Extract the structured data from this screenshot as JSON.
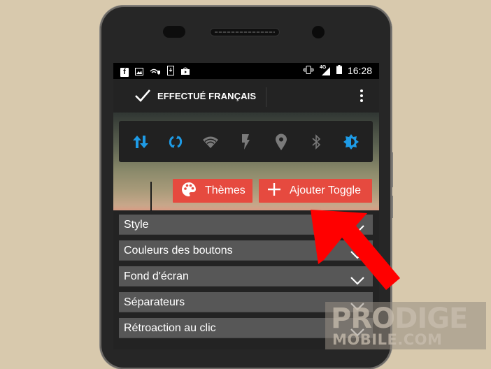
{
  "statusbar": {
    "left_icons": [
      "facebook-icon",
      "image-icon",
      "wifi-vpn-icon",
      "download-icon",
      "play-store-icon"
    ],
    "network_label": "4G",
    "time": "16:28"
  },
  "appbar": {
    "title": "EFFECTUÉ FRANÇAIS",
    "confirm_icon": "check-icon",
    "menu_icon": "more-vert-icon"
  },
  "toggles": [
    {
      "name": "mobile-data",
      "icon": "data-arrows-icon",
      "active": true
    },
    {
      "name": "sync",
      "icon": "sync-icon",
      "active": true
    },
    {
      "name": "wifi",
      "icon": "wifi-icon",
      "active": false
    },
    {
      "name": "flashlight",
      "icon": "flash-icon",
      "active": false
    },
    {
      "name": "location",
      "icon": "location-pin-icon",
      "active": false
    },
    {
      "name": "bluetooth",
      "icon": "bluetooth-icon",
      "active": false
    },
    {
      "name": "brightness",
      "icon": "brightness-icon",
      "active": true
    }
  ],
  "colors": {
    "active_toggle": "#1e9be6",
    "inactive_toggle": "#7a7a7a",
    "button_red": "#e64a3f",
    "annotation_arrow": "#ff0000"
  },
  "buttons": {
    "themes": "Thèmes",
    "add_toggle": "Ajouter Toggle"
  },
  "sections": [
    {
      "label": "Style"
    },
    {
      "label": "Couleurs des boutons"
    },
    {
      "label": "Fond d'écran"
    },
    {
      "label": "Séparateurs"
    },
    {
      "label": "Rétroaction au clic"
    }
  ],
  "watermark": {
    "line1": "PRODIGE",
    "line2": "MOBILE.COM"
  }
}
